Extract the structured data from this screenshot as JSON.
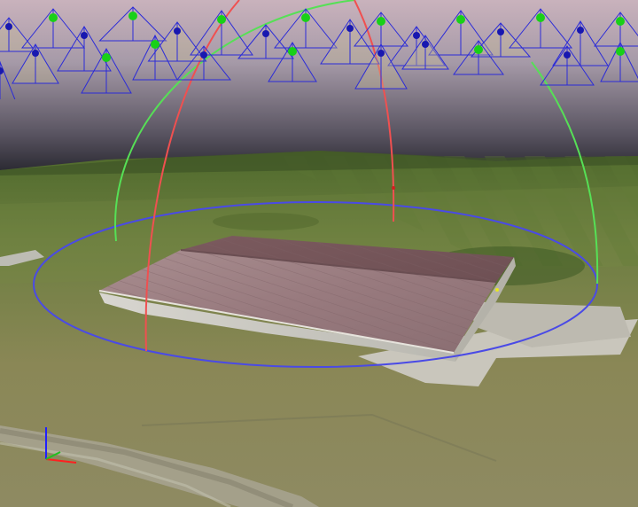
{
  "viewport": {
    "kind": "3D photogrammetry reconstruction view",
    "background_gradient": [
      "#b8a8b8",
      "#6f6878",
      "#2b2b30"
    ],
    "icons": [
      "camera-frustum-icon",
      "rotation-gizmo-icon",
      "axis-triad-icon"
    ]
  },
  "colors": {
    "frustum_wire": "#2b2bd8",
    "camera_center": "#1818b0",
    "camera_normal": "#18d018",
    "gizmo_ring": "#4a4ae6",
    "gizmo_arc_green": "#56e056",
    "gizmo_arc_red": "#f05050",
    "axis_x": "#ff2020",
    "axis_y": "#20c020",
    "axis_z": "#2020ff",
    "grass": "#6f7b48",
    "roof": "#8c6c70"
  }
}
